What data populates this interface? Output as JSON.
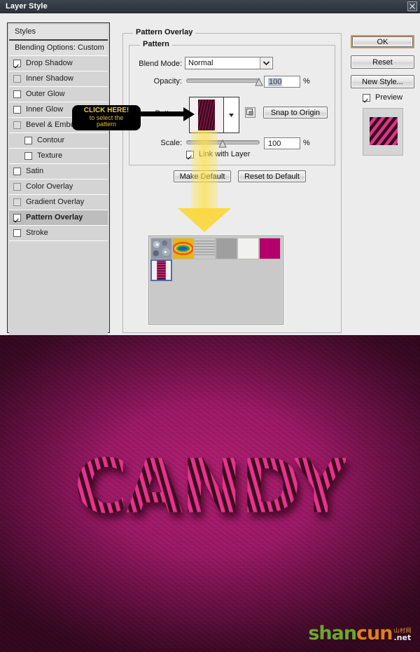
{
  "window": {
    "title": "Layer Style",
    "close_icon": "close-icon"
  },
  "styles_panel": {
    "header": "Styles",
    "blending_options": "Blending Options: Custom",
    "effects": [
      {
        "label": "Drop Shadow",
        "checked": true,
        "indent": false,
        "selected": false,
        "dim": false
      },
      {
        "label": "Inner Shadow",
        "checked": false,
        "indent": false,
        "selected": false,
        "dim": true
      },
      {
        "label": "Outer Glow",
        "checked": false,
        "indent": false,
        "selected": false,
        "dim": false
      },
      {
        "label": "Inner Glow",
        "checked": false,
        "indent": false,
        "selected": false,
        "dim": false
      },
      {
        "label": "Bevel & Emboss",
        "checked": false,
        "indent": false,
        "selected": false,
        "dim": true
      },
      {
        "label": "Contour",
        "checked": false,
        "indent": true,
        "selected": false,
        "dim": false
      },
      {
        "label": "Texture",
        "checked": false,
        "indent": true,
        "selected": false,
        "dim": false
      },
      {
        "label": "Satin",
        "checked": false,
        "indent": false,
        "selected": false,
        "dim": false
      },
      {
        "label": "Color Overlay",
        "checked": false,
        "indent": false,
        "selected": false,
        "dim": true
      },
      {
        "label": "Gradient Overlay",
        "checked": false,
        "indent": false,
        "selected": false,
        "dim": true
      },
      {
        "label": "Pattern Overlay",
        "checked": true,
        "indent": false,
        "selected": true,
        "dim": false
      },
      {
        "label": "Stroke",
        "checked": false,
        "indent": false,
        "selected": false,
        "dim": false
      }
    ]
  },
  "pattern_overlay": {
    "group_title": "Pattern Overlay",
    "subgroup_title": "Pattern",
    "blend_mode_label": "Blend Mode:",
    "blend_mode_value": "Normal",
    "opacity_label": "Opacity:",
    "opacity_value": "100",
    "opacity_unit": "%",
    "pattern_label": "Pattern:",
    "snap_to_origin": "Snap to Origin",
    "scale_label": "Scale:",
    "scale_value": "100",
    "scale_unit": "%",
    "link_with_layer": "Link with Layer",
    "link_with_layer_checked": true,
    "make_default": "Make Default",
    "reset_to_default": "Reset to Default"
  },
  "pattern_picker": {
    "swatches": [
      {
        "name": "clouds-bubbles-pattern",
        "selected": false
      },
      {
        "name": "rainbow-pattern",
        "selected": false
      },
      {
        "name": "gray-lines-pattern",
        "selected": false
      },
      {
        "name": "solid-gray-pattern",
        "selected": false
      },
      {
        "name": "white-paper-pattern",
        "selected": false
      },
      {
        "name": "magenta-solid-pattern",
        "selected": false
      },
      {
        "name": "candy-stripe-pattern",
        "selected": true
      }
    ]
  },
  "buttons": {
    "ok": "OK",
    "reset": "Reset",
    "new_style": "New Style...",
    "preview": "Preview",
    "preview_checked": true
  },
  "annotation": {
    "line1": "CLICK HERE!",
    "line2": "to select the",
    "line3": "pattern"
  },
  "artwork": {
    "text": "CANDY",
    "watermark_part1": "shan",
    "watermark_part2": "cun",
    "watermark_cn": "山村网",
    "watermark_tld": ".net"
  },
  "colors": {
    "title_bar": "#343a43",
    "dialog_bg": "#ececec",
    "ok_border": "#c79a55",
    "accent_magenta": "#b2186f",
    "stripe_dark": "#3a0d1e",
    "stripe_pink": "#e8318f",
    "callout_bg": "#000000",
    "callout_text": "#e3c84f",
    "beam_yellow": "#fad73c"
  }
}
